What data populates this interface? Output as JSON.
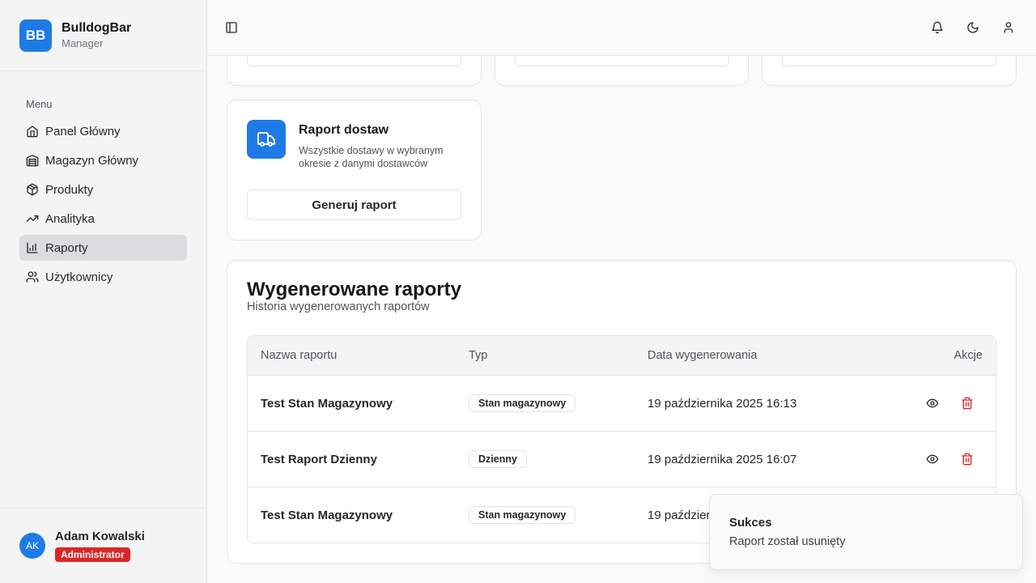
{
  "brand": {
    "logo": "BB",
    "name": "BulldogBar",
    "subtitle": "Manager"
  },
  "sidebar": {
    "menu_label": "Menu",
    "items": [
      {
        "label": "Panel Główny",
        "icon": "home-icon",
        "active": false
      },
      {
        "label": "Magazyn Główny",
        "icon": "warehouse-icon",
        "active": false
      },
      {
        "label": "Produkty",
        "icon": "package-icon",
        "active": false
      },
      {
        "label": "Analityka",
        "icon": "trending-up-icon",
        "active": false
      },
      {
        "label": "Raporty",
        "icon": "bar-chart-icon",
        "active": true
      },
      {
        "label": "Użytkownicy",
        "icon": "users-icon",
        "active": false
      }
    ],
    "user": {
      "initials": "AK",
      "name": "Adam Kowalski",
      "role": "Administrator"
    }
  },
  "header": {
    "icons": [
      "sidebar-toggle-icon",
      "bell-icon",
      "moon-icon",
      "user-icon"
    ]
  },
  "report_cards": {
    "delivery": {
      "title": "Raport dostaw",
      "description": "Wszystkie dostawy w wybranym okresie z danymi dostawców",
      "button": "Generuj raport",
      "icon": "truck-icon"
    }
  },
  "generated": {
    "title": "Wygenerowane raporty",
    "subtitle": "Historia wygenerowanych raportów",
    "columns": [
      "Nazwa raportu",
      "Typ",
      "Data wygenerowania",
      "Akcje"
    ],
    "rows": [
      {
        "name": "Test Stan Magazynowy",
        "type": "Stan magazynowy",
        "date": "19 października 2025 16:13"
      },
      {
        "name": "Test Raport Dzienny",
        "type": "Dzienny",
        "date": "19 października 2025 16:07"
      },
      {
        "name": "Test Stan Magazynowy",
        "type": "Stan magazynowy",
        "date": "19 października 2025 16:00"
      }
    ]
  },
  "toast": {
    "title": "Sukces",
    "message": "Raport został usunięty"
  },
  "colors": {
    "accent": "#1e7be6",
    "danger": "#dc2626"
  }
}
